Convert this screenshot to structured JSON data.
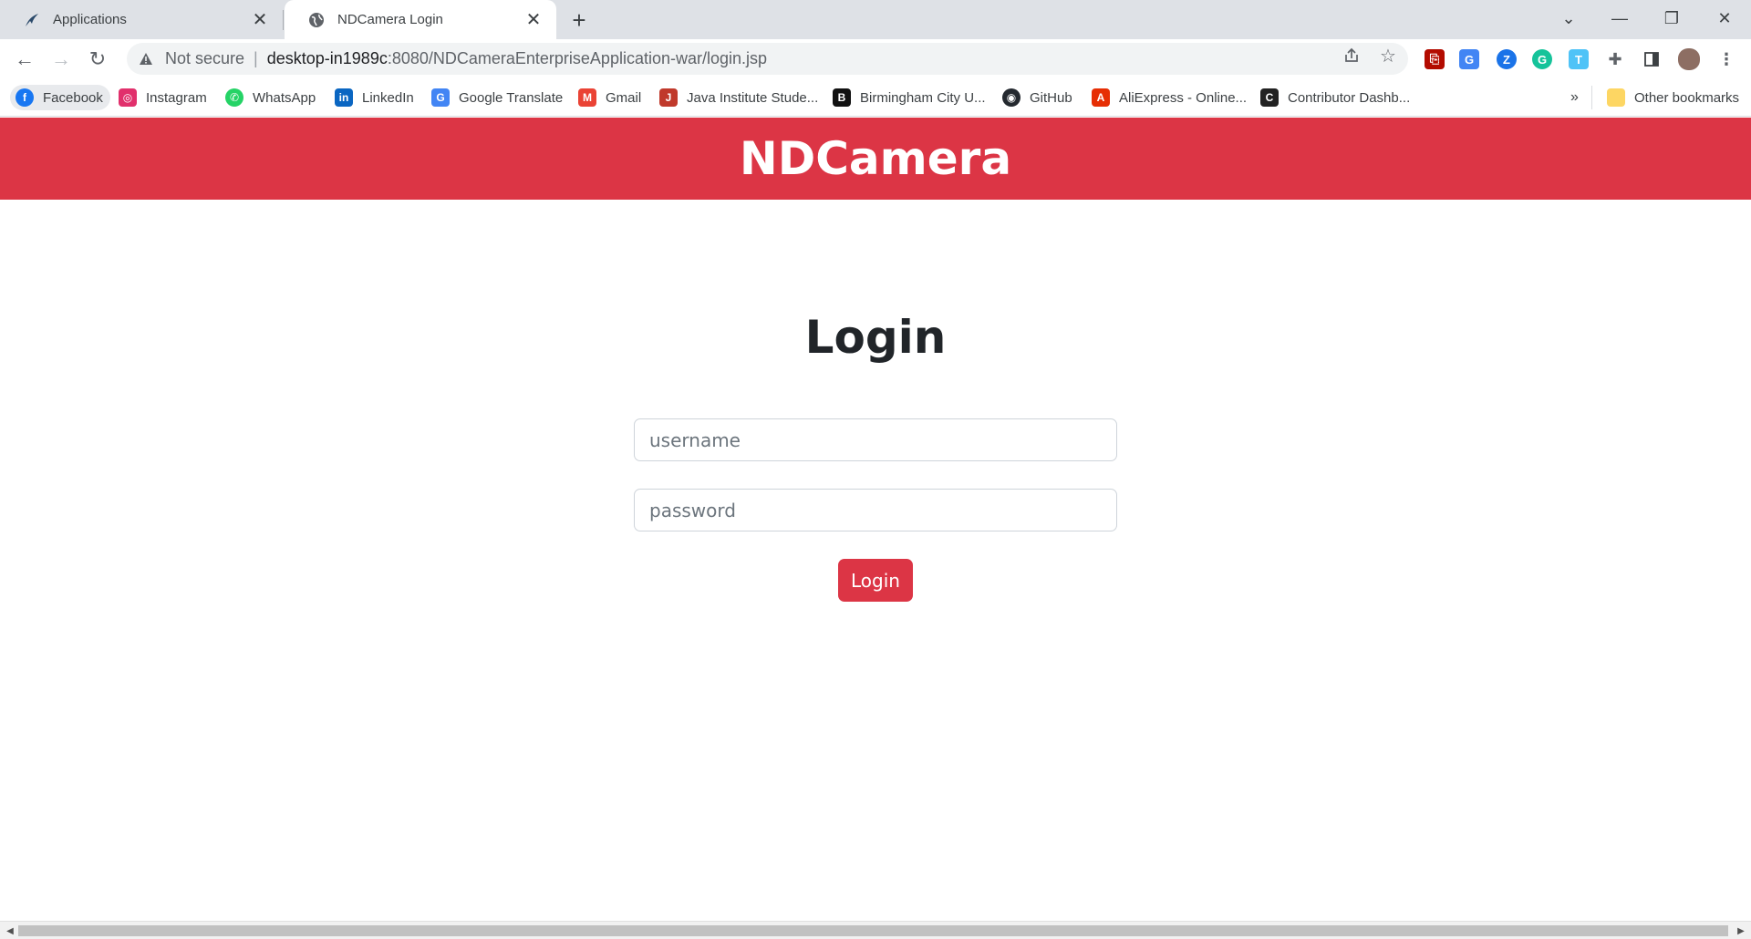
{
  "tabs": [
    {
      "title": "Applications",
      "close": "✕"
    },
    {
      "title": "NDCamera Login",
      "close": "✕"
    }
  ],
  "newtab": "+",
  "window": {
    "tab_search": "⌄",
    "minimize": "—",
    "restore": "❐",
    "close": "✕"
  },
  "nav": {
    "back": "←",
    "forward": "→",
    "reload": "↻"
  },
  "address": {
    "security_label": "Not secure",
    "separator": "|",
    "host": "desktop-in1989c",
    "path": ":8080/NDCameraEnterpriseApplication-war/login.jsp"
  },
  "bookmarks": [
    {
      "label": "Facebook",
      "color": "#1877f2",
      "glyph": "f"
    },
    {
      "label": "Instagram",
      "color": "#e1306c",
      "glyph": "◎"
    },
    {
      "label": "WhatsApp",
      "color": "#25d366",
      "glyph": "✆"
    },
    {
      "label": "LinkedIn",
      "color": "#0a66c2",
      "glyph": "in"
    },
    {
      "label": "Google Translate",
      "color": "#4285f4",
      "glyph": "G"
    },
    {
      "label": "Gmail",
      "color": "#ea4335",
      "glyph": "M"
    },
    {
      "label": "Java Institute Stude...",
      "color": "#c0392b",
      "glyph": "J"
    },
    {
      "label": "Birmingham City U...",
      "color": "#111111",
      "glyph": "B"
    },
    {
      "label": "GitHub",
      "color": "#24292f",
      "glyph": "◉"
    },
    {
      "label": "AliExpress - Online...",
      "color": "#e62e04",
      "glyph": "A"
    },
    {
      "label": "Contributor Dashb...",
      "color": "#222222",
      "glyph": "C"
    }
  ],
  "bookmarks_overflow": "»",
  "other_bookmarks": "Other bookmarks",
  "page": {
    "brand": "NDCamera",
    "heading": "Login",
    "username_placeholder": "username",
    "password_placeholder": "password",
    "login_button": "Login"
  },
  "colors": {
    "brand_red": "#dc3545"
  }
}
